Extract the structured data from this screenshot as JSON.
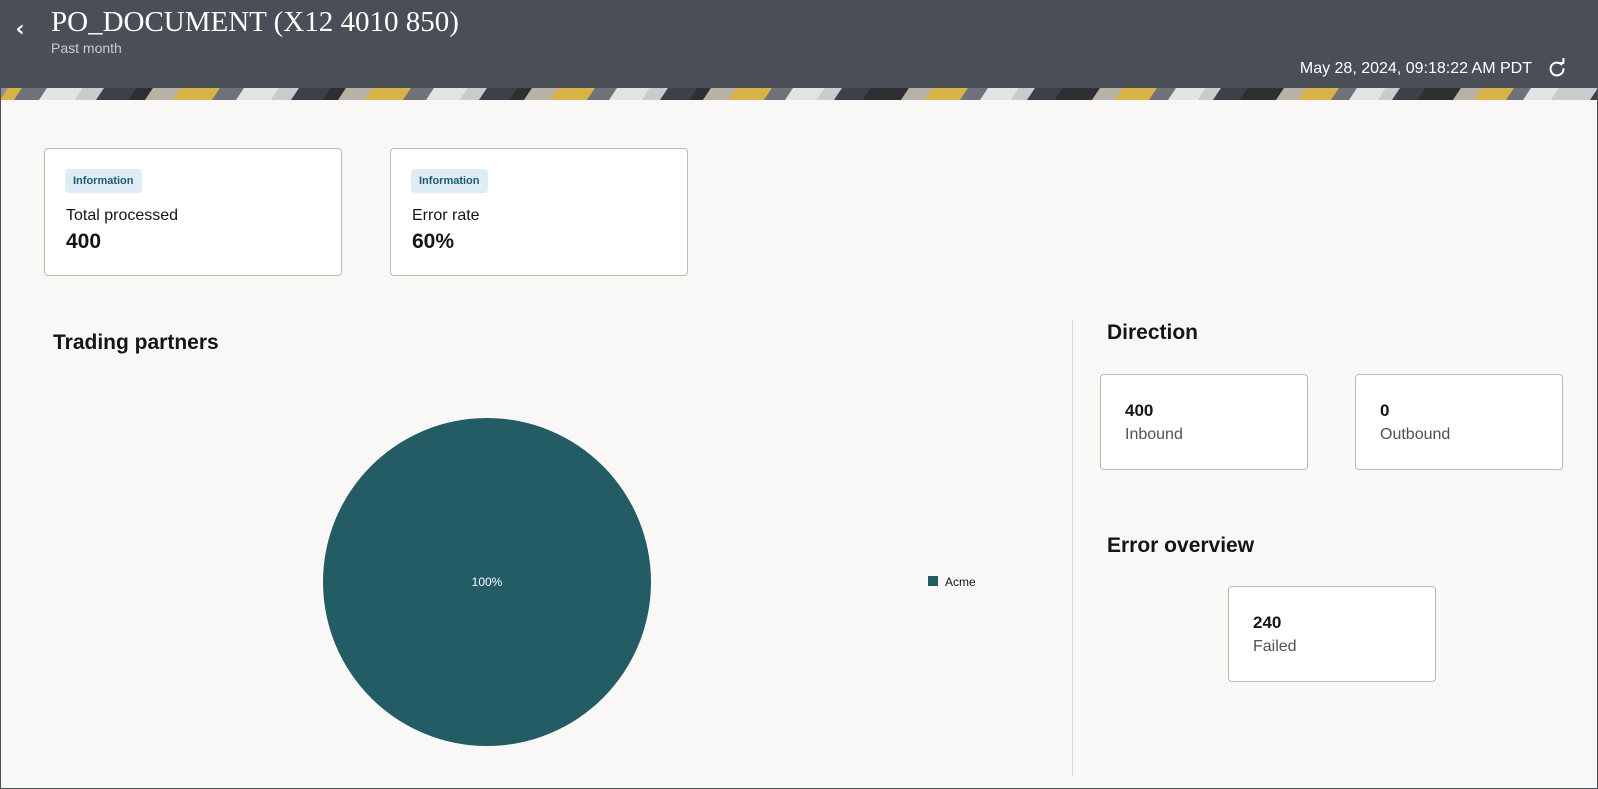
{
  "header": {
    "title": "PO_DOCUMENT (X12 4010 850)",
    "subtitle": "Past month",
    "timestamp": "May 28, 2024, 09:18:22 AM PDT",
    "background_color": "#4a4e56",
    "back_icon": "chevron-left-icon",
    "refresh_icon": "refresh-icon"
  },
  "kpis": [
    {
      "badge": "Information",
      "label": "Total processed",
      "value": "400"
    },
    {
      "badge": "Information",
      "label": "Error rate",
      "value": "60%"
    }
  ],
  "trading_partners": {
    "title": "Trading partners"
  },
  "direction": {
    "title": "Direction",
    "cards": [
      {
        "value": "400",
        "label": "Inbound"
      },
      {
        "value": "0",
        "label": "Outbound"
      }
    ]
  },
  "error_overview": {
    "title": "Error overview",
    "cards": [
      {
        "value": "240",
        "label": "Failed"
      }
    ]
  },
  "colors": {
    "page_background": "#f9f8f6",
    "badge_background": "#deedf4",
    "badge_text": "#1d5a78"
  },
  "chart_data": {
    "type": "pie",
    "title": "Trading partners",
    "categories": [
      "Acme"
    ],
    "values": [
      100
    ],
    "data_labels": [
      "100%"
    ],
    "colors": [
      "#245c65"
    ],
    "legend": {
      "placement": "right",
      "entries": [
        "Acme"
      ]
    }
  }
}
